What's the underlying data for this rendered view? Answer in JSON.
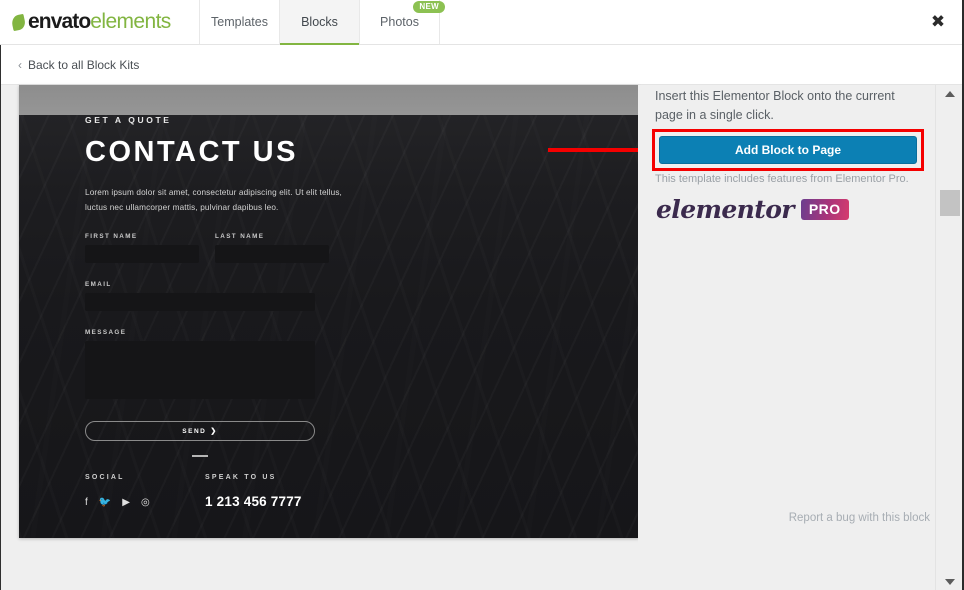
{
  "window": {
    "close_label": "✖"
  },
  "brand": {
    "primary": "envato",
    "secondary": "elements",
    "leaf_icon": "leaf-icon",
    "green": "#82b541"
  },
  "tabs": [
    {
      "label": "Templates",
      "active": false,
      "badge": null
    },
    {
      "label": "Blocks",
      "active": true,
      "badge": null
    },
    {
      "label": "Photos",
      "active": false,
      "badge": "NEW"
    }
  ],
  "breadcrumb": {
    "chevron": "‹",
    "label": "Back to all Block Kits"
  },
  "preview": {
    "eyebrow": "GET A QUOTE",
    "headline": "CONTACT US",
    "lede": "Lorem ipsum dolor sit amet, consectetur adipiscing elit. Ut elit tellus, luctus nec ullamcorper mattis, pulvinar dapibus leo.",
    "fields": [
      {
        "label": "FIRST NAME",
        "value": "",
        "size": "half"
      },
      {
        "label": "LAST NAME",
        "value": "",
        "size": "half"
      },
      {
        "label": "EMAIL",
        "value": "",
        "size": "full"
      },
      {
        "label": "MESSAGE",
        "value": "",
        "size": "textarea"
      }
    ],
    "send_label": "SEND",
    "send_arrow": "❯",
    "footer": {
      "social_label": "SOCIAL",
      "social_icons": [
        "facebook-icon",
        "twitter-icon",
        "youtube-icon",
        "instagram-icon"
      ],
      "social_glyphs": [
        "f",
        "🐦",
        "▶",
        "◎"
      ],
      "speak_label": "SPEAK TO US",
      "phone": "1 213 456 7777"
    }
  },
  "panel": {
    "insert_text": "Insert this Elementor Block onto the current page in a single click.",
    "add_block_label": "Add Block to Page",
    "pro_note": "This template includes features from Elementor Pro.",
    "elementor_word": "elementor",
    "pro_badge": "PRO",
    "report_bug": "Report a bug with this block",
    "button_color": "#0c80b4",
    "highlight_color": "#f50000"
  }
}
